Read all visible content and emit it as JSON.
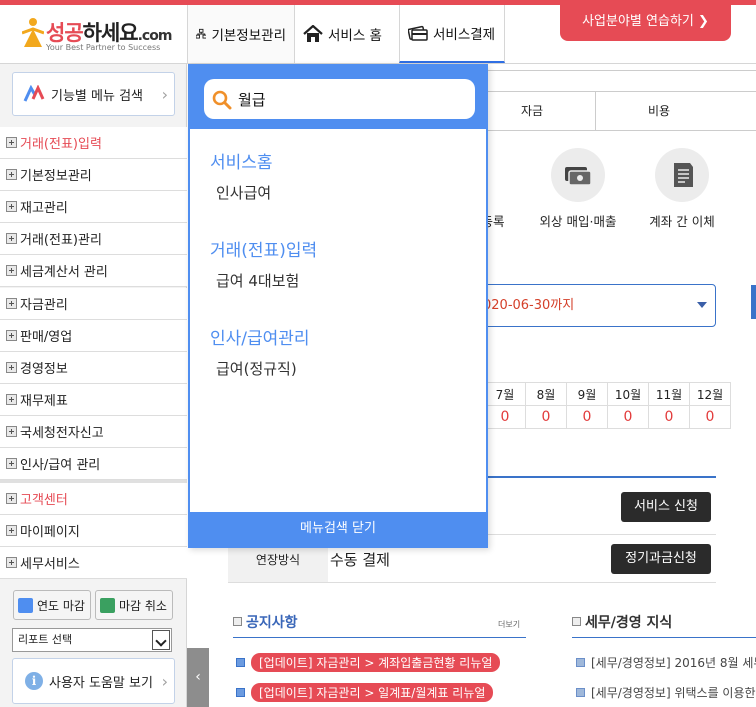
{
  "logo": {
    "brand": "하세요",
    "brand_first": "성공",
    "domain": ".com",
    "tagline": "Your Best Partner to Success"
  },
  "topnav": {
    "items": [
      {
        "label": "기본정보관리",
        "icon": "org-chart-icon"
      },
      {
        "label": "서비스 홈",
        "icon": "home-icon"
      },
      {
        "label": "서비스결제",
        "icon": "card-payment-icon"
      }
    ],
    "practice_button": "사업분야별 연습하기 ❯"
  },
  "sidebar": {
    "menu_search_label": "기능별 메뉴 검색",
    "items": [
      "거래(전표)입력",
      "기본정보관리",
      "재고관리",
      "거래(전표)관리",
      "세금계산서 관리",
      "자금관리",
      "판매/영업",
      "경영정보",
      "재무제표",
      "국세청전자신고",
      "인사/급여 관리"
    ],
    "items2": [
      "고객센터",
      "마이페이지",
      "세무서비스"
    ],
    "close_year_button": "연도 마감",
    "cancel_close_button": "마감 취소",
    "report_select": "리포트 선택",
    "help_button": "사용자 도움말 보기"
  },
  "main": {
    "tabs": [
      "자금",
      "비용"
    ],
    "quick_actions": [
      {
        "label": "등록",
        "icon": "register-icon"
      },
      {
        "label": "외상 매입·매출",
        "icon": "money-exchange-icon"
      },
      {
        "label": "계좌 간 이체",
        "icon": "transfer-document-icon"
      }
    ],
    "period_text": "020-06-30까지",
    "months": [
      "7월",
      "8월",
      "9월",
      "10월",
      "11월",
      "12월"
    ],
    "month_values": [
      "0",
      "0",
      "0",
      "0",
      "0",
      "0"
    ],
    "service_apply_button": "서비스 신청",
    "renew_label": "연장방식",
    "renew_value": "수동 결제",
    "regular_billing_button": "정기과금신청",
    "notice": {
      "title": "공지사항",
      "more": "더보기",
      "items": [
        "[업데이트] 자금관리 > 계좌입출금현황 리뉴얼",
        "[업데이트] 자금관리 > 일계표/월계표 리뉴얼"
      ]
    },
    "knowledge": {
      "title": "세무/경영 지식",
      "items": [
        "[세무/경영정보] 2016년 8월 세무",
        "[세무/경영정보] 위택스를 이용한 "
      ]
    }
  },
  "search_panel": {
    "query": "월급",
    "groups": [
      {
        "title": "서비스홈",
        "items": [
          "인사급여"
        ]
      },
      {
        "title": "거래(전표)입력",
        "items": [
          "급여 4대보험"
        ]
      },
      {
        "title": "인사/급여관리",
        "items": [
          "급여(정규직)"
        ]
      }
    ],
    "close_label": "메뉴검색 닫기"
  },
  "colors": {
    "brand_red": "#e64b55",
    "accent_blue": "#4f8ef0",
    "dark_button": "#2b2b2b"
  }
}
